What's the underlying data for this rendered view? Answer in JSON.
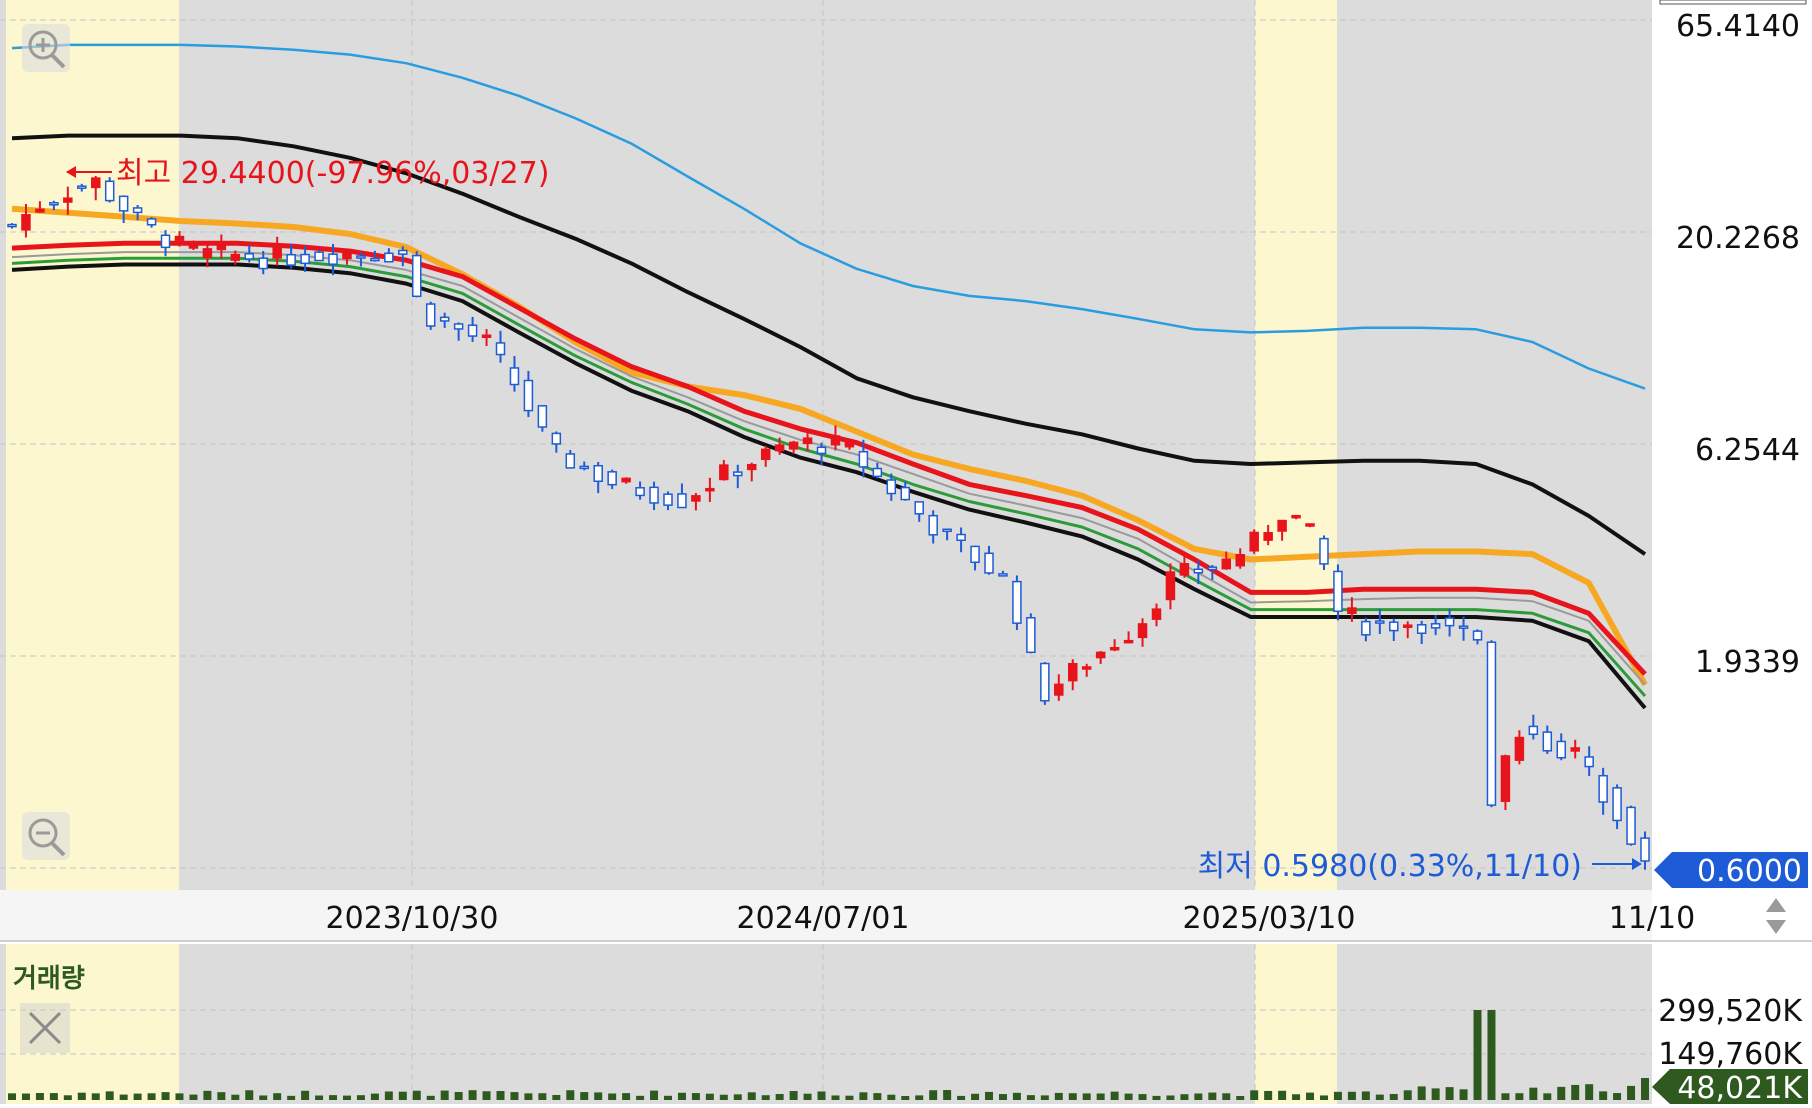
{
  "chart_data": {
    "type": "line",
    "subtype": "candlestick with moving-average envelopes and volume",
    "price_axis": {
      "scale": "log",
      "tick_labels": [
        "65.4140",
        "20.2268",
        "6.2544",
        "1.9339"
      ],
      "tick_values": [
        65.414,
        20.2268,
        6.2544,
        1.9339
      ],
      "range": [
        0.59,
        65.414
      ]
    },
    "x_axis": {
      "tick_labels": [
        "2023/10/30",
        "2024/07/01",
        "2025/03/10",
        "11/10"
      ]
    },
    "annotations": {
      "high": "최고 29.4400(-97.96%,03/27)",
      "low": "최저 0.5980(0.33%,11/10)",
      "current_price": "0.6000"
    },
    "volume_panel": {
      "title": "거래량",
      "tick_labels": [
        "299,520K",
        "149,760K"
      ],
      "tick_values": [
        299520,
        149760
      ],
      "current_volume": "48,021K"
    },
    "colors": {
      "up": "#e8141c",
      "down": "#1e5bd6",
      "volume": "#2e5a1f",
      "highlight": "#fdf7cf",
      "plot_bg": "#dcdcdc",
      "line_blue": "#2a9de0",
      "line_black": "#111111",
      "line_orange": "#f7a823",
      "line_red": "#e8141c",
      "line_green": "#2c9c3a",
      "line_gray": "#9a9a9a"
    },
    "series": [
      {
        "values": [
          56,
          57,
          57,
          57,
          56.5,
          55.5,
          54,
          51.5,
          47.5,
          43,
          38,
          33,
          27.5,
          23,
          19,
          16.5,
          15,
          14.2,
          13.8,
          13.2,
          12.5,
          11.8,
          11.6,
          11.7,
          11.9,
          11.9,
          11.8,
          11,
          9.5,
          8.5
        ]
      },
      {
        "values": [
          34,
          34.5,
          34.5,
          34.5,
          34,
          32.5,
          30.5,
          28,
          25,
          22,
          19.5,
          17,
          14.5,
          12.5,
          10.7,
          9,
          8.1,
          7.5,
          7,
          6.6,
          6.1,
          5.7,
          5.6,
          5.65,
          5.7,
          5.7,
          5.6,
          5,
          4.2,
          3.4
        ]
      },
      {
        "values": [
          23,
          22.5,
          22,
          21.5,
          21.2,
          20.8,
          20,
          18.6,
          16,
          13.4,
          11,
          9.3,
          8.6,
          8.2,
          7.6,
          6.7,
          5.9,
          5.45,
          5.1,
          4.7,
          4.1,
          3.5,
          3.3,
          3.35,
          3.4,
          3.45,
          3.45,
          3.4,
          2.9,
          1.65
        ]
      },
      {
        "values": [
          18.5,
          18.8,
          19,
          19,
          19,
          18.7,
          18.2,
          17.3,
          15.8,
          13.3,
          11.2,
          9.6,
          8.6,
          7.5,
          6.8,
          6.3,
          5.6,
          5,
          4.7,
          4.4,
          3.9,
          3.3,
          2.75,
          2.75,
          2.8,
          2.8,
          2.8,
          2.75,
          2.45,
          1.75
        ]
      },
      {
        "values": [
          17.6,
          17.9,
          18.1,
          18.1,
          18.1,
          17.8,
          17.3,
          16.4,
          15,
          12.6,
          10.6,
          9.1,
          8.1,
          7.1,
          6.4,
          5.9,
          5.3,
          4.75,
          4.45,
          4.15,
          3.7,
          3.1,
          2.6,
          2.62,
          2.65,
          2.67,
          2.67,
          2.62,
          2.35,
          1.65
        ]
      },
      {
        "values": [
          17,
          17.3,
          17.5,
          17.5,
          17.5,
          17.2,
          16.7,
          15.8,
          14.4,
          12.1,
          10.2,
          8.8,
          7.8,
          6.8,
          6.1,
          5.6,
          5,
          4.55,
          4.25,
          3.95,
          3.5,
          2.95,
          2.5,
          2.5,
          2.5,
          2.5,
          2.5,
          2.45,
          2.2,
          1.55
        ]
      },
      {
        "values": [
          16.4,
          16.7,
          16.9,
          16.9,
          16.9,
          16.6,
          16.1,
          15.2,
          13.8,
          11.6,
          9.8,
          8.4,
          7.5,
          6.5,
          5.8,
          5.35,
          4.8,
          4.35,
          4.05,
          3.75,
          3.3,
          2.8,
          2.4,
          2.4,
          2.4,
          2.4,
          2.4,
          2.35,
          2.1,
          1.45
        ]
      }
    ]
  }
}
